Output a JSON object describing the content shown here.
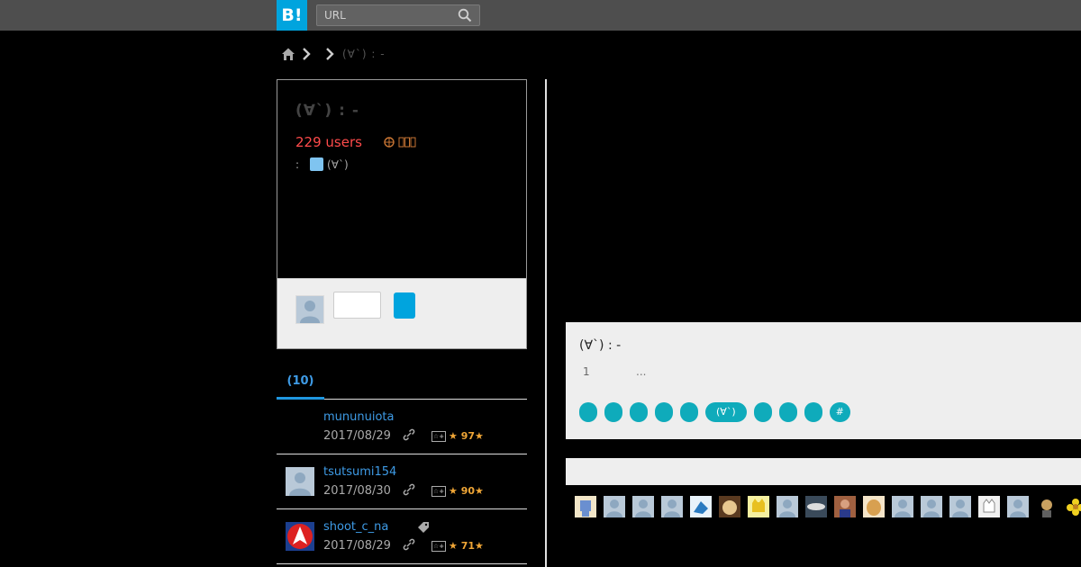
{
  "header": {
    "logo_text": "B!",
    "search_placeholder": "URL"
  },
  "breadcrumb": {
    "current": "(∀`) :  -"
  },
  "entry": {
    "title": "(∀`) :  -",
    "users": "229 users",
    "source_prefix": ":",
    "source_name": "(∀`)"
  },
  "tabs": {
    "active_label": "(10)"
  },
  "bookmarks": [
    {
      "user": "mununuiota",
      "date": "2017/08/29",
      "stars": "97"
    },
    {
      "user": "tsutsumi154",
      "date": "2017/08/30",
      "stars": "90"
    },
    {
      "user": "shoot_c_na",
      "date": "2017/08/29",
      "stars": "71"
    }
  ],
  "entry_card": {
    "title": "(∀`) :  -",
    "rank": "1",
    "more": "...",
    "tag_label": "(∀`)",
    "hash_label": "#"
  },
  "colors": {
    "accent": "#00a4de",
    "users": "#ff4b4b",
    "link": "#3e9be6",
    "tag": "#0fabbb"
  }
}
